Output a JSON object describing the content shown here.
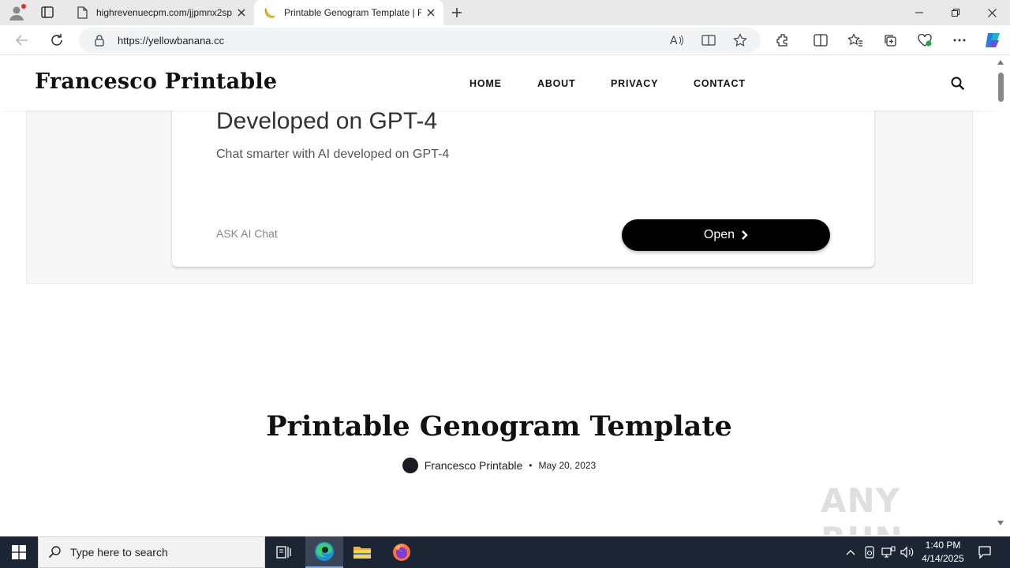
{
  "browser": {
    "tabs": [
      {
        "title": "highrevenuecpm.com/jjpmnx2sp"
      },
      {
        "title": "Printable Genogram Template | F"
      }
    ],
    "url": "https://yellowbanana.cc"
  },
  "site": {
    "brand": "Francesco Printable",
    "nav": [
      "HOME",
      "ABOUT",
      "PRIVACY",
      "CONTACT"
    ]
  },
  "ad": {
    "headline": "Developed on GPT-4",
    "subline": "Chat smarter with AI developed on GPT-4",
    "advertiser": "ASK AI Chat",
    "cta": "Open"
  },
  "post": {
    "title": "Printable Genogram Template",
    "author": "Francesco Printable",
    "separator": "•",
    "date": "May 20, 2023"
  },
  "watermark": "ANY RUN",
  "taskbar": {
    "search_placeholder": "Type here to search",
    "time": "1:40 PM",
    "date": "4/14/2025"
  },
  "colors": {
    "taskbar": "#1c2533",
    "cta_bg": "#000000",
    "tab_strip": "#e9e9e9"
  }
}
